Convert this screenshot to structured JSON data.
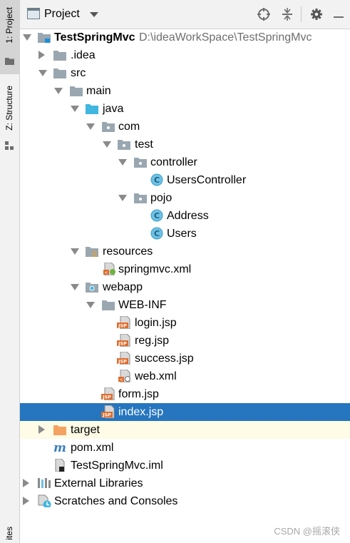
{
  "sidebar": {
    "tabs": [
      {
        "label": "1: Project",
        "active": true
      },
      {
        "label": "Z: Structure",
        "active": false
      },
      {
        "label": "ites",
        "active": false
      }
    ]
  },
  "header": {
    "title": "Project",
    "buttons": [
      "crosshair-icon",
      "collapse-icon",
      "gear-icon",
      "hide-icon"
    ]
  },
  "tree": {
    "root_label": "TestSpringMvc",
    "root_path": "D:\\ideaWorkSpace\\TestSpringMvc",
    "idea": ".idea",
    "src": "src",
    "main": "main",
    "java": "java",
    "com": "com",
    "test": "test",
    "controller": "controller",
    "users_controller": "UsersController",
    "pojo": "pojo",
    "address": "Address",
    "users": "Users",
    "resources": "resources",
    "springmvc_xml": "springmvc.xml",
    "webapp": "webapp",
    "web_inf": "WEB-INF",
    "login_jsp": "login.jsp",
    "reg_jsp": "reg.jsp",
    "success_jsp": "success.jsp",
    "web_xml": "web.xml",
    "form_jsp": "form.jsp",
    "index_jsp": "index.jsp",
    "target": "target",
    "pom_xml": "pom.xml",
    "iml": "TestSpringMvc.iml",
    "external_libraries": "External Libraries",
    "scratches": "Scratches and Consoles"
  },
  "icon_badges": {
    "class": "C",
    "jsp": "JSP",
    "maven": "m"
  },
  "colors": {
    "selection": "#2675bf",
    "folder": "#9aa7b0",
    "source_folder": "#40b6e0",
    "excluded_folder": "#f4a261",
    "highlight_row": "#fefbe6"
  },
  "watermark": "CSDN @摇滚侠"
}
